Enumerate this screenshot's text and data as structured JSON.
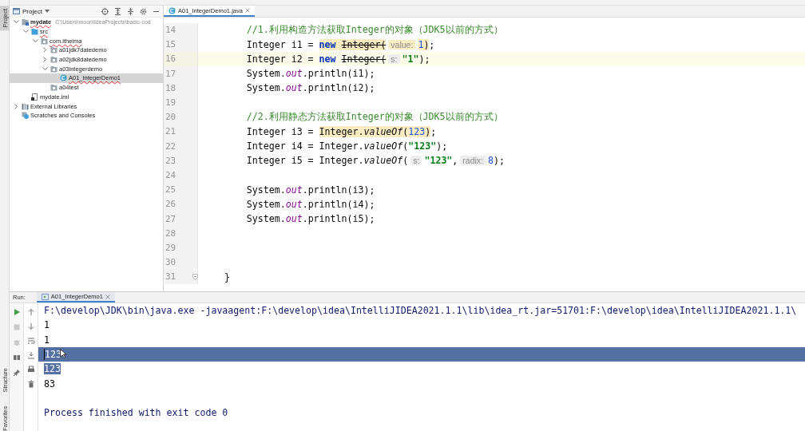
{
  "tool_stripe": [
    {
      "label": "Project",
      "selected": true
    },
    {
      "label": "Structure",
      "selected": false
    },
    {
      "label": "Favorites",
      "selected": false
    }
  ],
  "project": {
    "title": "Project",
    "tree": [
      {
        "label": "mydate",
        "detail": "C:\\Users\\moon\\IdeaProjects\\basic-cod",
        "kind": "module",
        "expanded": true,
        "error": true,
        "selected": false,
        "children": [
          {
            "label": "src",
            "kind": "source",
            "expanded": true,
            "error": true,
            "selected": false,
            "children": [
              {
                "label": "com.itheima",
                "kind": "package",
                "expanded": true,
                "error": true,
                "selected": false,
                "children": [
                  {
                    "label": "a01jdk7datedemo",
                    "kind": "package",
                    "expanded": false,
                    "error": false,
                    "selected": false
                  },
                  {
                    "label": "a02jdk8datedemo",
                    "kind": "package",
                    "expanded": false,
                    "error": false,
                    "selected": false
                  },
                  {
                    "label": "a03integerdemo",
                    "kind": "package",
                    "expanded": true,
                    "error": false,
                    "selected": false,
                    "children": [
                      {
                        "label": "A01_IntegerDemo1",
                        "kind": "class",
                        "error": true,
                        "selected": true
                      }
                    ]
                  },
                  {
                    "label": "a04test",
                    "kind": "package",
                    "error": false,
                    "selected": false
                  }
                ]
              }
            ]
          },
          {
            "label": "mydate.iml",
            "kind": "file",
            "error": false,
            "selected": false
          }
        ]
      },
      {
        "label": "External Libraries",
        "kind": "library",
        "expanded": false,
        "error": false,
        "selected": false
      },
      {
        "label": "Scratches and Consoles",
        "kind": "scratch",
        "error": false,
        "selected": false
      }
    ]
  },
  "editor": {
    "tabs": [
      {
        "label": "A01_IntegerDemo1.java",
        "selected": true
      }
    ],
    "lines": [
      {
        "number": "14",
        "current": false,
        "tokens": [
          {
            "kind": "comment",
            "text": "        //1.利用构造方法获取Integer的对象（JDK5以前的方式）",
            "marked": false
          }
        ]
      },
      {
        "number": "15",
        "current": false,
        "tokens": [
          {
            "kind": "plain",
            "text": "        Integer i1 = ",
            "marked": false
          },
          {
            "kind": "keyword",
            "text": "new ",
            "marked": true
          },
          {
            "kind": "deprecated",
            "text": "Integer(",
            "marked": true
          },
          {
            "kind": "hint",
            "text": "value:",
            "marked": true
          },
          {
            "kind": "number",
            "text": "1",
            "marked": true
          },
          {
            "kind": "plain",
            "text": ")",
            "marked": true
          },
          {
            "kind": "plain",
            "text": ";",
            "marked": false
          }
        ]
      },
      {
        "number": "16",
        "current": true,
        "tokens": [
          {
            "kind": "plain",
            "text": "        Integer i2 = ",
            "marked": false
          },
          {
            "kind": "keyword",
            "text": "new ",
            "marked": false
          },
          {
            "kind": "deprecated",
            "text": "Integer(",
            "marked": false
          },
          {
            "kind": "hint",
            "text": "s:",
            "marked": false
          },
          {
            "kind": "string",
            "text": "\"1\"",
            "marked": false
          },
          {
            "kind": "plain",
            "text": ");",
            "marked": false
          }
        ]
      },
      {
        "number": "17",
        "current": false,
        "tokens": [
          {
            "kind": "plain",
            "text": "        System.",
            "marked": false
          },
          {
            "kind": "field",
            "text": "out",
            "marked": false
          },
          {
            "kind": "plain",
            "text": ".println(i1);",
            "marked": false
          }
        ]
      },
      {
        "number": "18",
        "current": false,
        "tokens": [
          {
            "kind": "plain",
            "text": "        System.",
            "marked": false
          },
          {
            "kind": "field",
            "text": "out",
            "marked": false
          },
          {
            "kind": "plain",
            "text": ".println(i2);",
            "marked": false
          }
        ]
      },
      {
        "number": "19",
        "current": false
      },
      {
        "number": "20",
        "current": false,
        "tokens": [
          {
            "kind": "comment",
            "text": "        //2.利用静态方法获取Integer的对象（JDK5以前的方式）",
            "marked": false
          }
        ]
      },
      {
        "number": "21",
        "current": false,
        "tokens": [
          {
            "kind": "plain",
            "text": "        Integer i3 = ",
            "marked": false
          },
          {
            "kind": "plain",
            "text": "Integer.",
            "marked": true
          },
          {
            "kind": "method",
            "text": "valueOf",
            "marked": true
          },
          {
            "kind": "plain",
            "text": "(",
            "marked": true
          },
          {
            "kind": "number",
            "text": "123",
            "marked": true
          },
          {
            "kind": "plain",
            "text": ")",
            "marked": true
          },
          {
            "kind": "plain",
            "text": ";",
            "marked": false
          }
        ]
      },
      {
        "number": "22",
        "current": false,
        "tokens": [
          {
            "kind": "plain",
            "text": "        Integer i4 = Integer.",
            "marked": false
          },
          {
            "kind": "method",
            "text": "valueOf",
            "marked": false
          },
          {
            "kind": "plain",
            "text": "(",
            "marked": false
          },
          {
            "kind": "string",
            "text": "\"123\"",
            "marked": false
          },
          {
            "kind": "plain",
            "text": ");",
            "marked": false
          }
        ]
      },
      {
        "number": "23",
        "current": false,
        "tokens": [
          {
            "kind": "plain",
            "text": "        Integer i5 = Integer.",
            "marked": false
          },
          {
            "kind": "method",
            "text": "valueOf",
            "marked": false
          },
          {
            "kind": "plain",
            "text": "(",
            "marked": false
          },
          {
            "kind": "hint",
            "text": "s:",
            "marked": false
          },
          {
            "kind": "string",
            "text": "\"123\"",
            "marked": false
          },
          {
            "kind": "plain",
            "text": ",",
            "marked": false
          },
          {
            "kind": "hint",
            "text": "radix:",
            "marked": false
          },
          {
            "kind": "number",
            "text": "8",
            "marked": false
          },
          {
            "kind": "plain",
            "text": ");",
            "marked": false
          }
        ]
      },
      {
        "number": "24",
        "current": false
      },
      {
        "number": "25",
        "current": false,
        "tokens": [
          {
            "kind": "plain",
            "text": "        System.",
            "marked": false
          },
          {
            "kind": "field",
            "text": "out",
            "marked": false
          },
          {
            "kind": "plain",
            "text": ".println(i3);",
            "marked": false
          }
        ]
      },
      {
        "number": "26",
        "current": false,
        "tokens": [
          {
            "kind": "plain",
            "text": "        System.",
            "marked": false
          },
          {
            "kind": "field",
            "text": "out",
            "marked": false
          },
          {
            "kind": "plain",
            "text": ".println(i4);",
            "marked": false
          }
        ]
      },
      {
        "number": "27",
        "current": false,
        "tokens": [
          {
            "kind": "plain",
            "text": "        System.",
            "marked": false
          },
          {
            "kind": "field",
            "text": "out",
            "marked": false
          },
          {
            "kind": "plain",
            "text": ".println(i5);",
            "marked": false
          }
        ]
      },
      {
        "number": "28",
        "current": false
      },
      {
        "number": "29",
        "current": false
      },
      {
        "number": "30",
        "current": false
      },
      {
        "number": "31",
        "current": false,
        "fold": true,
        "tokens": [
          {
            "kind": "plain",
            "text": "    }",
            "marked": false
          }
        ]
      }
    ]
  },
  "run_panel": {
    "label": "Run:",
    "tabs": [
      {
        "label": "A01_IntegerDemo1",
        "selected": true
      }
    ],
    "output": [
      {
        "kind": "command",
        "text": "F:\\develop\\JDK\\bin\\java.exe -javaagent:F:\\develop\\idea\\IntelliJIDEA2021.1.1\\lib\\idea_rt.jar=51701:F:\\develop\\idea\\IntelliJIDEA2021.1.1\\",
        "selected": false,
        "current": false
      },
      {
        "kind": "stdout",
        "text": "1",
        "selected": false,
        "current": false
      },
      {
        "kind": "stdout",
        "text": "1",
        "selected": false,
        "current": false
      },
      {
        "kind": "stdout",
        "text": "123",
        "selected": true,
        "current": true
      },
      {
        "kind": "stdout",
        "text": "123",
        "selected": true,
        "current": false
      },
      {
        "kind": "stdout",
        "text": "83",
        "selected": false,
        "current": false
      },
      {
        "kind": "exit",
        "text": "Process finished with exit code 0",
        "selected": false,
        "current": false
      }
    ]
  }
}
